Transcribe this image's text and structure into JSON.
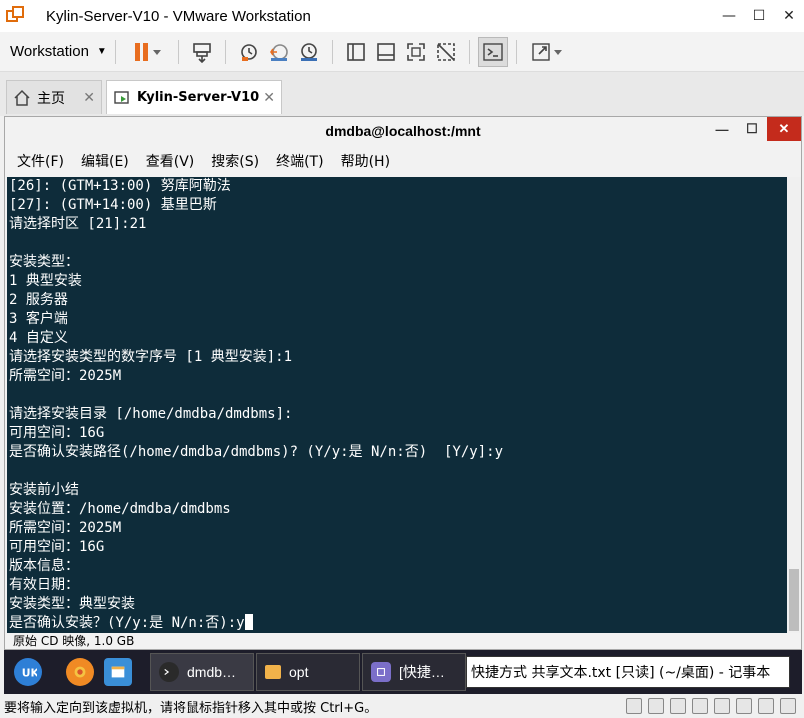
{
  "app": {
    "title": "Kylin-Server-V10 - VMware Workstation",
    "window_controls": [
      "—",
      "☐",
      "✕"
    ]
  },
  "toolbar": {
    "menu_label": "Workstation"
  },
  "tabs": [
    {
      "label": "主页"
    },
    {
      "label": "Kylin-Server-V10"
    }
  ],
  "terminal": {
    "title": "dmdba@localhost:/mnt",
    "menu": [
      "文件(F)",
      "编辑(E)",
      "查看(V)",
      "搜索(S)",
      "终端(T)",
      "帮助(H)"
    ],
    "lines": [
      "[26]: (GTM+13:00) 努库阿勒法",
      "[27]: (GTM+14:00) 基里巴斯",
      "请选择时区 [21]:21",
      "",
      "安装类型：",
      "1 典型安装",
      "2 服务器",
      "3 客户端",
      "4 自定义",
      "请选择安装类型的数字序号 [1 典型安装]:1",
      "所需空间：2025M",
      "",
      "请选择安装目录 [/home/dmdba/dmdbms]:",
      "可用空间：16G",
      "是否确认安装路径(/home/dmdba/dmdbms)? (Y/y:是 N/n:否)  [Y/y]:y",
      "",
      "安装前小结",
      "安装位置：/home/dmdba/dmdbms",
      "所需空间：2025M",
      "可用空间：16G",
      "版本信息：",
      "有效日期：",
      "安装类型：典型安装",
      "是否确认安装？(Y/y:是 N/n:否):y"
    ],
    "cd_status": "原始 CD 映像, 1.0 GB"
  },
  "taskbar": {
    "items": [
      {
        "label": "dmdb…",
        "icon": "terminal-icon"
      },
      {
        "label": "opt",
        "icon": "folder-icon"
      },
      {
        "label": "[快捷…",
        "icon": "notepad-icon"
      },
      {
        "label": "快捷方式 共享文本.txt [只读] (~/桌面) - 记事本",
        "icon": ""
      }
    ]
  },
  "bottom_status": {
    "text": "要将输入定向到该虚拟机，请将鼠标指针移入其中或按 Ctrl+G。"
  },
  "colors": {
    "terminal_bg": "#0e2c3a",
    "pause_orange": "#e86d1f",
    "close_red": "#c42b1c"
  }
}
